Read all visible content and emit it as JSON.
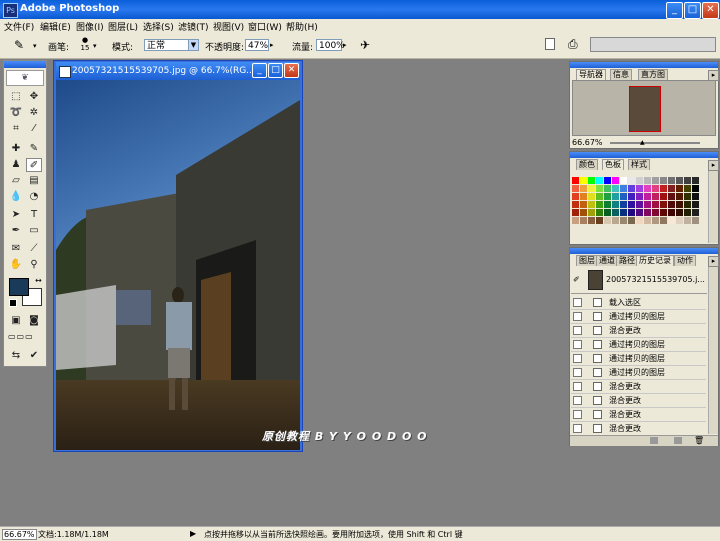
{
  "app": {
    "title": "Adobe Photoshop"
  },
  "window_buttons": {
    "minimize": "_",
    "maximize": "□",
    "close": "✕"
  },
  "menu": [
    "文件(F)",
    "编辑(E)",
    "图像(I)",
    "图层(L)",
    "选择(S)",
    "滤镜(T)",
    "视图(V)",
    "窗口(W)",
    "帮助(H)"
  ],
  "options": {
    "brush_label": "画笔:",
    "brush_size": "15",
    "mode_label": "模式:",
    "mode_value": "正常",
    "opacity_label": "不透明度:",
    "opacity_value": "47%",
    "flow_label": "流量:",
    "flow_value": "100%"
  },
  "document": {
    "title": "20057321515539705.jpg @ 66.7%(RG...",
    "zoom": "66.67%",
    "file_size": "文档:1.18M/1.18M"
  },
  "navigator": {
    "tabs": [
      "导航器",
      "信息",
      "直方图"
    ],
    "zoom": "66.67%"
  },
  "swatches": {
    "tabs": [
      "颜色",
      "色板",
      "样式"
    ],
    "colors": [
      "#ff0000",
      "#ffff00",
      "#00ff00",
      "#00ffff",
      "#0000ff",
      "#ff00ff",
      "#ffffff",
      "#e8e8e8",
      "#d0d0d0",
      "#b8b8b8",
      "#a0a0a0",
      "#888888",
      "#707070",
      "#585858",
      "#404040",
      "#282828",
      "#f06040",
      "#f0a040",
      "#f0f040",
      "#80e040",
      "#40c060",
      "#40c0c0",
      "#4080e0",
      "#6040e0",
      "#a040e0",
      "#e040c0",
      "#e04080",
      "#c02020",
      "#802020",
      "#602000",
      "#404000",
      "#000000",
      "#e04020",
      "#e08020",
      "#e0e020",
      "#60c020",
      "#20a040",
      "#20a0a0",
      "#2060c0",
      "#4020c0",
      "#8020c0",
      "#c020a0",
      "#c02060",
      "#a01010",
      "#601010",
      "#501800",
      "#303000",
      "#101010",
      "#c03010",
      "#c06010",
      "#c0c010",
      "#40a010",
      "#108030",
      "#108080",
      "#1040a0",
      "#3010a0",
      "#6010a0",
      "#a01080",
      "#a01040",
      "#801008",
      "#500808",
      "#401000",
      "#282800",
      "#181818",
      "#a02008",
      "#a05008",
      "#a0a008",
      "#308008",
      "#086020",
      "#086060",
      "#083080",
      "#200880",
      "#500880",
      "#800860",
      "#800830",
      "#600804",
      "#400404",
      "#300c00",
      "#202000",
      "#202020",
      "#c8a080",
      "#a88060",
      "#886040",
      "#684020",
      "#d8c8b0",
      "#b8a890",
      "#988870",
      "#786850",
      "#f0d8c0",
      "#d0b8a0",
      "#b09880",
      "#907860",
      "#f8e8d8",
      "#e0d0c0",
      "#c0b0a0",
      "#a09080"
    ]
  },
  "history": {
    "tabs": [
      "图层",
      "通道",
      "路径",
      "历史记录",
      "动作"
    ],
    "snapshot": "20057321515539705.j...",
    "items": [
      "载入选区",
      "通过拷贝的图层",
      "混合更改",
      "通过拷贝的图层",
      "通过拷贝的图层",
      "通过拷贝的图层",
      "混合更改",
      "混合更改",
      "混合更改",
      "混合更改",
      "混合更改"
    ]
  },
  "status": {
    "hint": "点按并拖移以从当前所选快照绘画。要用附加选项，使用 Shift 和 Ctrl 键"
  },
  "watermark": "原创教程  B Y  Y O O D O O",
  "colors": {
    "foreground": "#1a3a5a",
    "background": "#ffffff",
    "title_bar": "#1d5fd4"
  }
}
